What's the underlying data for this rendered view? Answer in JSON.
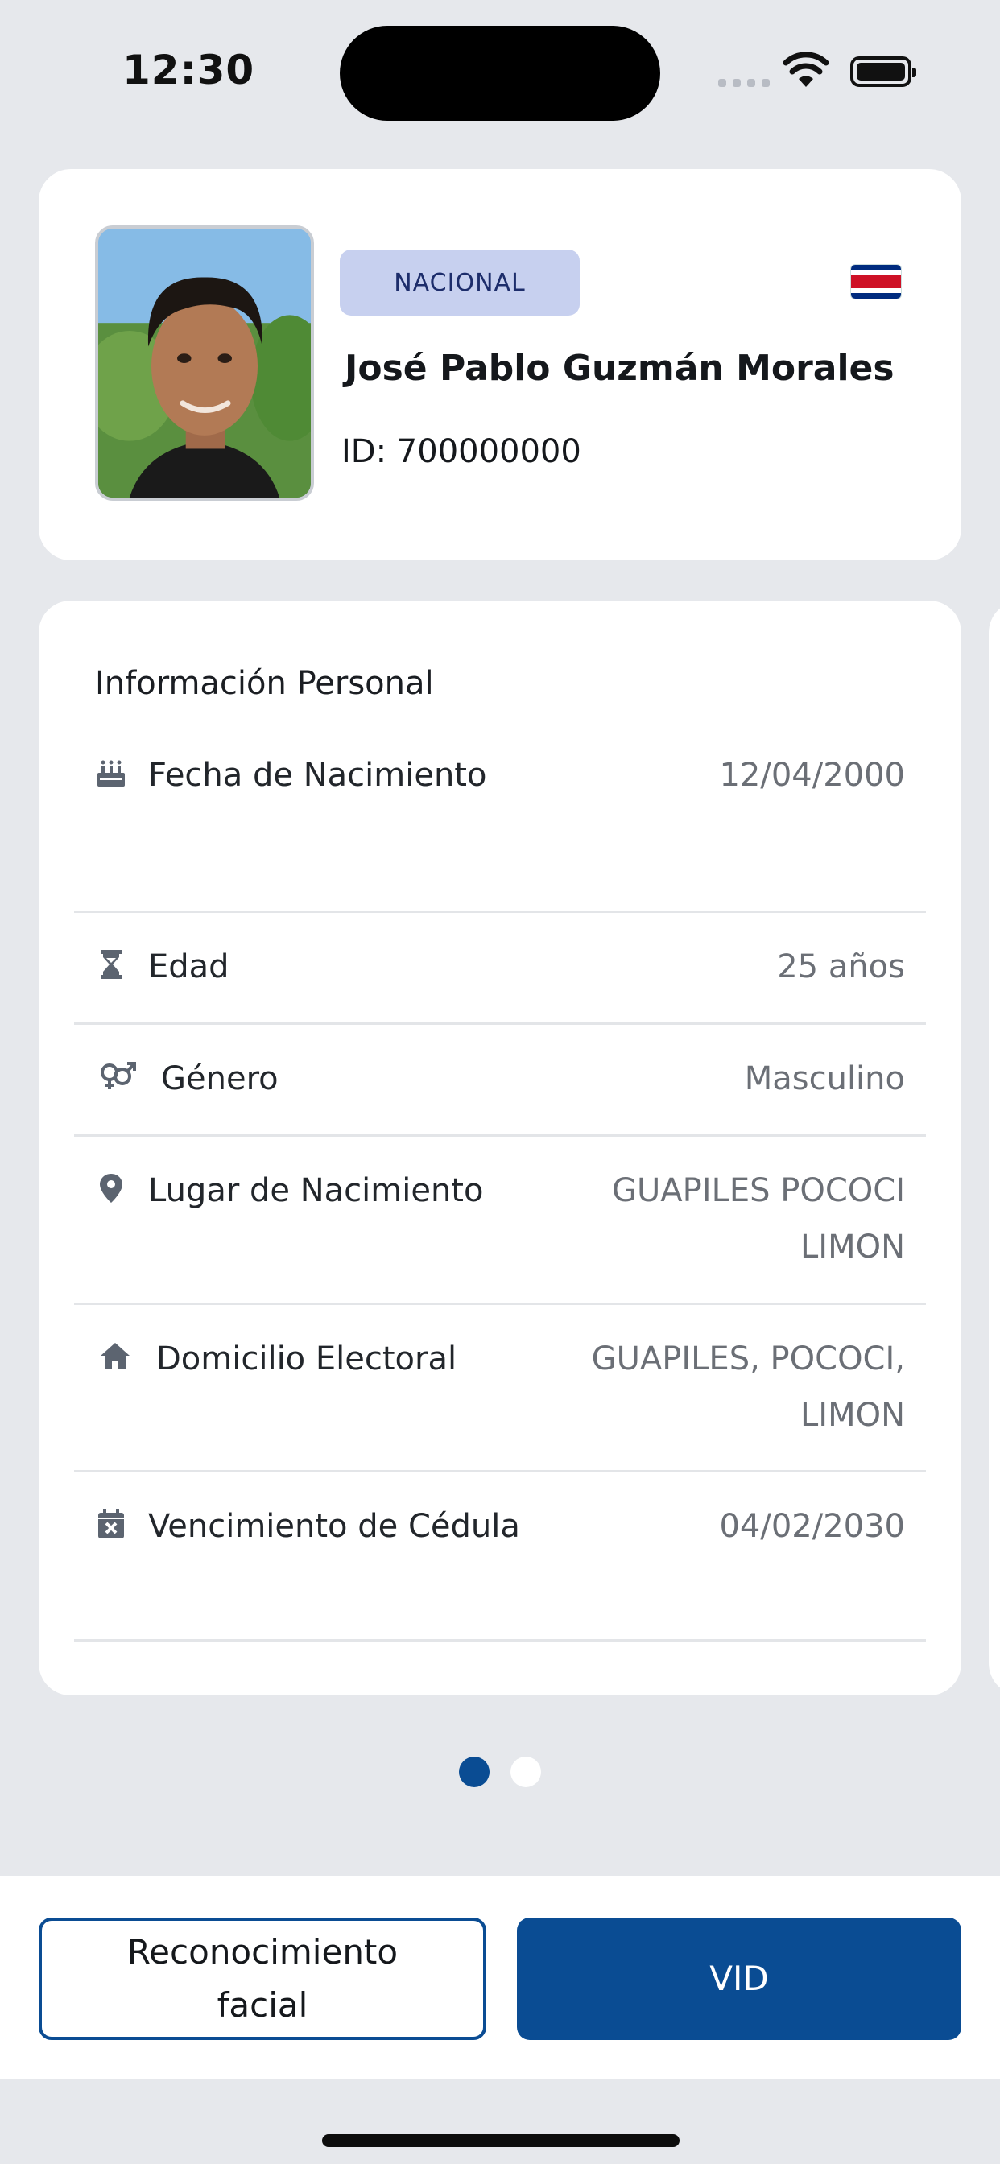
{
  "status_bar": {
    "time": "12:30"
  },
  "header": {
    "badge": "NACIONAL",
    "full_name": "José Pablo Guzmán Morales",
    "id_label": "ID: 700000000"
  },
  "personal_info": {
    "title": "Información Personal",
    "rows": [
      {
        "label": "Fecha de Nacimiento",
        "value": "12/04/2000",
        "icon": "cake-icon"
      },
      {
        "label": "Edad",
        "value": "25 años",
        "icon": "hourglass-icon"
      },
      {
        "label": "Género",
        "value": "Masculino",
        "icon": "gender-icon"
      },
      {
        "label": "Lugar de Nacimiento",
        "value": "GUAPILES POCOCI LIMON",
        "icon": "location-pin-icon"
      },
      {
        "label": "Domicilio Electoral",
        "value": "GUAPILES, POCOCI, LIMON",
        "icon": "home-icon"
      },
      {
        "label": "Vencimiento de Cédula",
        "value": "04/02/2030",
        "icon": "calendar-x-icon"
      }
    ]
  },
  "pager": {
    "total": 2,
    "active": 1
  },
  "actions": {
    "facial_label": "Reconocimiento facial",
    "vid_label": "VID"
  },
  "colors": {
    "accent": "#0a4c93",
    "badge_bg": "#c7d0ef",
    "background": "#e6e8ec"
  }
}
